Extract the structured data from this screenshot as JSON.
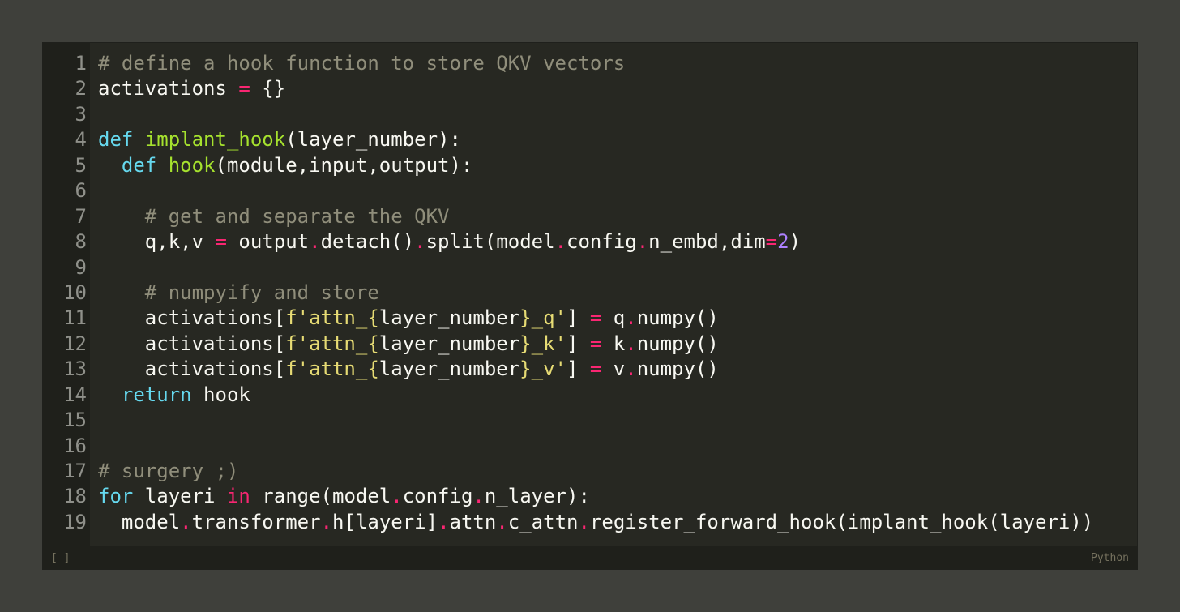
{
  "status_bar": {
    "left": "[ ]",
    "language": "Python"
  },
  "lines": [
    [
      {
        "t": "# define a hook function to store QKV vectors",
        "c": "c"
      }
    ],
    [
      {
        "t": "activations ",
        "c": "t"
      },
      {
        "t": "=",
        "c": "o"
      },
      {
        "t": " {}",
        "c": "t"
      }
    ],
    [],
    [
      {
        "t": "def",
        "c": "k"
      },
      {
        "t": " ",
        "c": "t"
      },
      {
        "t": "implant_hook",
        "c": "f"
      },
      {
        "t": "(layer_number):",
        "c": "t"
      }
    ],
    [
      {
        "t": "  ",
        "c": "t"
      },
      {
        "t": "def",
        "c": "k"
      },
      {
        "t": " ",
        "c": "t"
      },
      {
        "t": "hook",
        "c": "f"
      },
      {
        "t": "(module,input,output):",
        "c": "t"
      }
    ],
    [],
    [
      {
        "t": "    ",
        "c": "t"
      },
      {
        "t": "# get and separate the QKV",
        "c": "c"
      }
    ],
    [
      {
        "t": "    q,k,v ",
        "c": "t"
      },
      {
        "t": "=",
        "c": "o"
      },
      {
        "t": " output",
        "c": "t"
      },
      {
        "t": ".",
        "c": "o"
      },
      {
        "t": "detach()",
        "c": "t"
      },
      {
        "t": ".",
        "c": "o"
      },
      {
        "t": "split(model",
        "c": "t"
      },
      {
        "t": ".",
        "c": "o"
      },
      {
        "t": "config",
        "c": "t"
      },
      {
        "t": ".",
        "c": "o"
      },
      {
        "t": "n_embd,dim",
        "c": "t"
      },
      {
        "t": "=",
        "c": "o"
      },
      {
        "t": "2",
        "c": "n"
      },
      {
        "t": ")",
        "c": "t"
      }
    ],
    [],
    [
      {
        "t": "    ",
        "c": "t"
      },
      {
        "t": "# numpyify and store",
        "c": "c"
      }
    ],
    [
      {
        "t": "    activations[",
        "c": "t"
      },
      {
        "t": "f'attn_{",
        "c": "s"
      },
      {
        "t": "layer_number",
        "c": "t"
      },
      {
        "t": "}_q'",
        "c": "s"
      },
      {
        "t": "] ",
        "c": "t"
      },
      {
        "t": "=",
        "c": "o"
      },
      {
        "t": " q",
        "c": "t"
      },
      {
        "t": ".",
        "c": "o"
      },
      {
        "t": "numpy()",
        "c": "t"
      }
    ],
    [
      {
        "t": "    activations[",
        "c": "t"
      },
      {
        "t": "f'attn_{",
        "c": "s"
      },
      {
        "t": "layer_number",
        "c": "t"
      },
      {
        "t": "}_k'",
        "c": "s"
      },
      {
        "t": "] ",
        "c": "t"
      },
      {
        "t": "=",
        "c": "o"
      },
      {
        "t": " k",
        "c": "t"
      },
      {
        "t": ".",
        "c": "o"
      },
      {
        "t": "numpy()",
        "c": "t"
      }
    ],
    [
      {
        "t": "    activations[",
        "c": "t"
      },
      {
        "t": "f'attn_{",
        "c": "s"
      },
      {
        "t": "layer_number",
        "c": "t"
      },
      {
        "t": "}_v'",
        "c": "s"
      },
      {
        "t": "] ",
        "c": "t"
      },
      {
        "t": "=",
        "c": "o"
      },
      {
        "t": " v",
        "c": "t"
      },
      {
        "t": ".",
        "c": "o"
      },
      {
        "t": "numpy()",
        "c": "t"
      }
    ],
    [
      {
        "t": "  ",
        "c": "t"
      },
      {
        "t": "return",
        "c": "k"
      },
      {
        "t": " hook",
        "c": "t"
      }
    ],
    [],
    [],
    [
      {
        "t": "# surgery ;)",
        "c": "c"
      }
    ],
    [
      {
        "t": "for",
        "c": "k"
      },
      {
        "t": " layeri ",
        "c": "t"
      },
      {
        "t": "in",
        "c": "o"
      },
      {
        "t": " range(model",
        "c": "t"
      },
      {
        "t": ".",
        "c": "o"
      },
      {
        "t": "config",
        "c": "t"
      },
      {
        "t": ".",
        "c": "o"
      },
      {
        "t": "n_layer):",
        "c": "t"
      }
    ],
    [
      {
        "t": "  model",
        "c": "t"
      },
      {
        "t": ".",
        "c": "o"
      },
      {
        "t": "transformer",
        "c": "t"
      },
      {
        "t": ".",
        "c": "o"
      },
      {
        "t": "h[layeri]",
        "c": "t"
      },
      {
        "t": ".",
        "c": "o"
      },
      {
        "t": "attn",
        "c": "t"
      },
      {
        "t": ".",
        "c": "o"
      },
      {
        "t": "c_attn",
        "c": "t"
      },
      {
        "t": ".",
        "c": "o"
      },
      {
        "t": "register_forward_hook(implant_hook(layeri))",
        "c": "t"
      }
    ]
  ]
}
